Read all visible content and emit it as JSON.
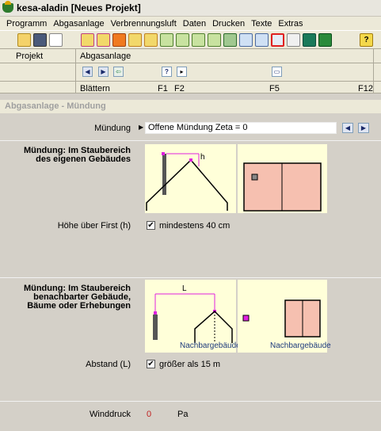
{
  "window": {
    "title": "kesa-aladin [Neues Projekt]"
  },
  "menu": [
    "Programm",
    "Abgasanlage",
    "Verbrennungsluft",
    "Daten",
    "Drucken",
    "Texte",
    "Extras"
  ],
  "toolbar": {
    "help_label": "?"
  },
  "fkeys": {
    "projekt": "Projekt",
    "abgasanlage": "Abgasanlage",
    "blaettern": "Blättern",
    "f1": "F1",
    "f2": "F2",
    "f5": "F5",
    "f12": "F12",
    "help_label": "?"
  },
  "panel": {
    "header": "Abgasanlage - Mündung"
  },
  "muendung": {
    "label": "Mündung",
    "value": "Offene Mündung Zeta = 0"
  },
  "staubereich_eigen": {
    "label_line1": "Mündung: Im Staubereich",
    "label_line2": "des eigenen Gebäudes",
    "dim_label": "h"
  },
  "hoehe": {
    "label": "Höhe über First (h)",
    "checkbox_label": "mindestens 40 cm",
    "checked": true
  },
  "staubereich_nachbar": {
    "label_line1": "Mündung: Im Staubereich",
    "label_line2": "benachbarter Gebäude,",
    "label_line3": "Bäume oder Erhebungen",
    "dim_label": "L",
    "caption_left": "Nachbargebäude",
    "caption_right": "Nachbargebäude"
  },
  "abstand": {
    "label": "Abstand (L)",
    "checkbox_label": "größer als 15 m",
    "checked": true
  },
  "winddruck": {
    "label": "Winddruck",
    "value": "0",
    "unit": "Pa"
  }
}
